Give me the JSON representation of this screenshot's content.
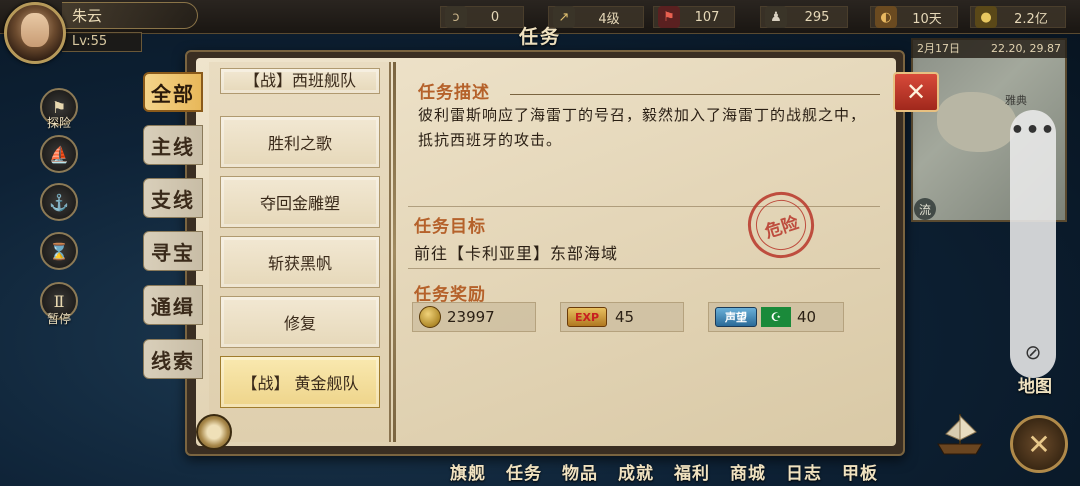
{
  "player": {
    "name": "朱云",
    "level": "Lv:55"
  },
  "resources": [
    {
      "icon": "strength-icon",
      "glyph": "ↄ",
      "value": "0"
    },
    {
      "icon": "navigation-icon",
      "glyph": "↗",
      "value": "4级"
    },
    {
      "icon": "crew-icon",
      "glyph": "⚑",
      "value": "107"
    },
    {
      "icon": "sailor-icon",
      "glyph": "♟",
      "value": "295"
    },
    {
      "icon": "food-icon",
      "glyph": "◐",
      "value": "10天"
    },
    {
      "icon": "gold-icon",
      "glyph": "●",
      "value": "2.2亿"
    }
  ],
  "hud": {
    "title": "任务"
  },
  "left_buttons": [
    {
      "label": "探险",
      "icon": "flag-icon",
      "glyph": "⚑"
    },
    {
      "label": "",
      "icon": "sail-icon",
      "glyph": "⛵"
    },
    {
      "label": "",
      "icon": "anchor-icon",
      "glyph": "⚓"
    },
    {
      "label": "",
      "icon": "hourglass-icon",
      "glyph": "⌛"
    },
    {
      "label": "暂停",
      "icon": "pause-icon",
      "glyph": "Ⅱ"
    }
  ],
  "minimap": {
    "date": "2月17日",
    "coords": "22.20, 29.87",
    "place": "雅典",
    "flow_label": "流"
  },
  "categories": [
    {
      "label": "全部",
      "active": true
    },
    {
      "label": "主线",
      "active": false
    },
    {
      "label": "支线",
      "active": false
    },
    {
      "label": "寻宝",
      "active": false
    },
    {
      "label": "通缉",
      "active": false
    },
    {
      "label": "线索",
      "active": false
    }
  ],
  "quests": [
    {
      "label": "【战】西班舰队",
      "selected": false
    },
    {
      "label": "胜利之歌",
      "selected": false
    },
    {
      "label": "夺回金雕塑",
      "selected": false
    },
    {
      "label": "斩获黑帆",
      "selected": false
    },
    {
      "label": "修复",
      "selected": false
    },
    {
      "label": "【战】 黄金舰队",
      "selected": true
    }
  ],
  "detail": {
    "desc_title": "任务描述",
    "description": "彼利雷斯响应了海雷丁的号召，毅然加入了海雷丁的战舰之中，抵抗西班牙的攻击。",
    "goal_title": "任务目标",
    "goal": "前往【卡利亚里】东部海域",
    "reward_title": "任务奖励",
    "danger_stamp": "危险",
    "rewards": {
      "gold": "23997",
      "exp_badge": "EXP",
      "exp": "45",
      "fame_badge": "声望",
      "fame_flag": "☪",
      "fame": "40"
    }
  },
  "close_label": "✕",
  "bottom_nav": [
    "旗舰",
    "任务",
    "物品",
    "成就",
    "福利",
    "商城",
    "日志",
    "甲板"
  ],
  "side_panel": {
    "dots": "•••",
    "hide_icon": "⊘"
  },
  "map_button": "地图",
  "colors": {
    "accent": "#b5612a",
    "close_red": "#d84a3a",
    "stamp_red": "#b8362a",
    "tab_active": "#e8b85a"
  }
}
